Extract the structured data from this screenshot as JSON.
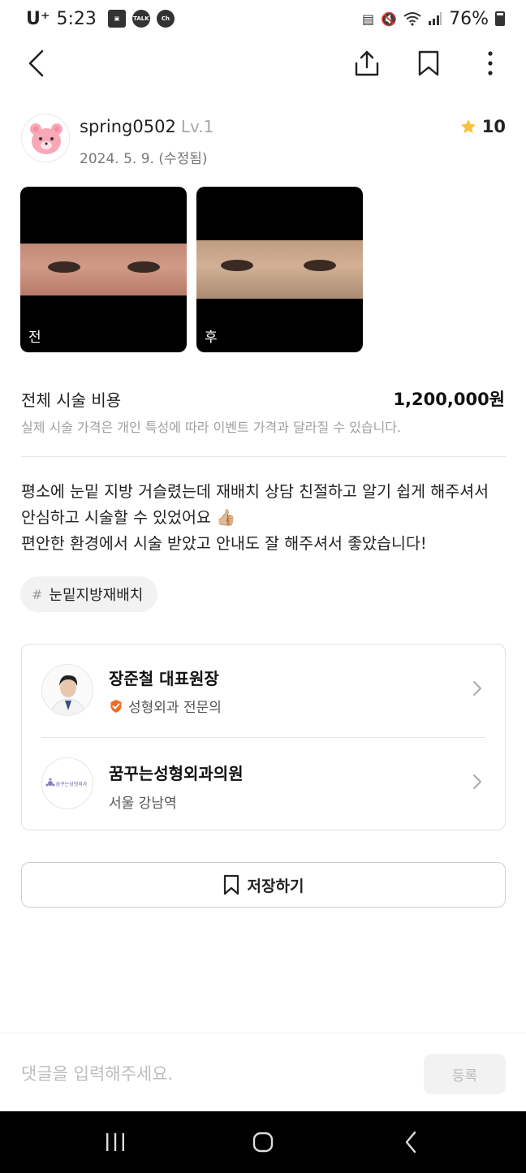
{
  "status_bar": {
    "carrier": "U⁺",
    "time": "5:23",
    "notification_icons": [
      "gallery-icon",
      "kakaotalk-icon",
      "channel-icon"
    ],
    "talk_label": "TALK",
    "channel_label": "Ch",
    "battery_percent": "76%"
  },
  "author": {
    "username": "spring0502",
    "level": "Lv.1",
    "date": "2024. 5. 9. (수정됨)",
    "rating": "10"
  },
  "photos": [
    {
      "label": "전"
    },
    {
      "label": "후"
    }
  ],
  "cost": {
    "title": "전체 시술 비용",
    "value": "1,200,000원",
    "note": "실제 시술 가격은 개인 특성에 따라 이벤트 가격과 달라질 수 있습니다."
  },
  "review": {
    "text": "평소에 눈밑 지방 거슬렸는데 재배치 상담 친절하고 알기 쉽게 해주셔서\n안심하고 시술할 수 있었어요 👍🏼\n편안한 환경에서 시술 받았고 안내도 잘 해주셔서 좋았습니다!"
  },
  "tag": {
    "hash": "#",
    "label": "눈밑지방재배치"
  },
  "doctor": {
    "name": "장준철 대표원장",
    "specialty": "성형외과 전문의"
  },
  "clinic": {
    "name": "꿈꾸는성형외과의원",
    "location": "서울 강남역",
    "logo_text": "꿈꾸는성형외과"
  },
  "save_button": {
    "label": "저장하기"
  },
  "comment": {
    "placeholder": "댓글을 입력해주세요.",
    "submit_label": "등록"
  },
  "colors": {
    "accent_star": "#f5c33b",
    "badge_orange": "#f06a24",
    "text_muted": "#a0a0a0"
  }
}
